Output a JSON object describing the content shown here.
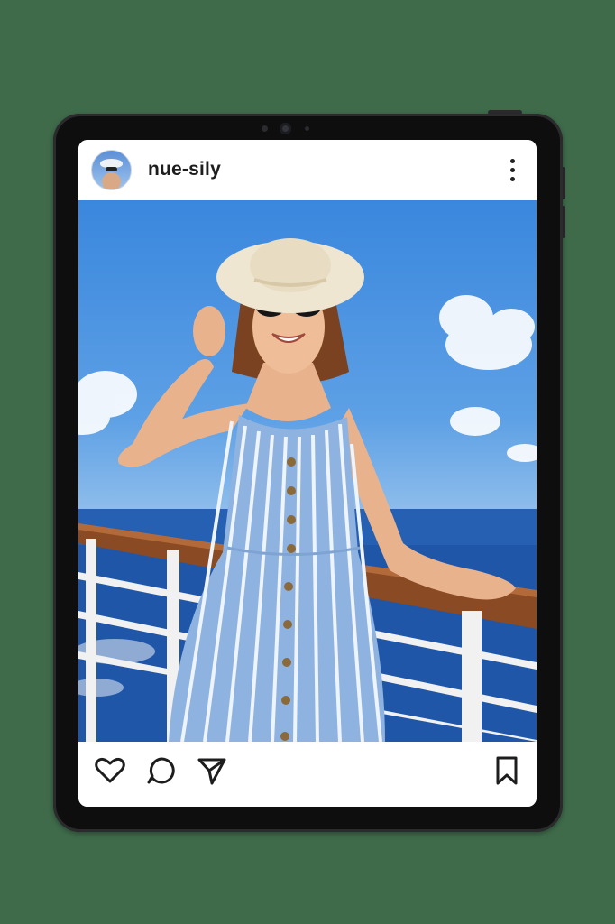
{
  "post": {
    "username": "nue-sily",
    "avatar_icon": "profile-avatar",
    "menu_icon": "more-vertical-icon"
  },
  "actions": {
    "like_icon": "heart-icon",
    "comment_icon": "comment-icon",
    "share_icon": "send-icon",
    "save_icon": "bookmark-icon"
  },
  "colors": {
    "background": "#3f6b4b",
    "device": "#0e0e0f",
    "sky": "#4a93e0",
    "sea": "#1f55a6"
  }
}
